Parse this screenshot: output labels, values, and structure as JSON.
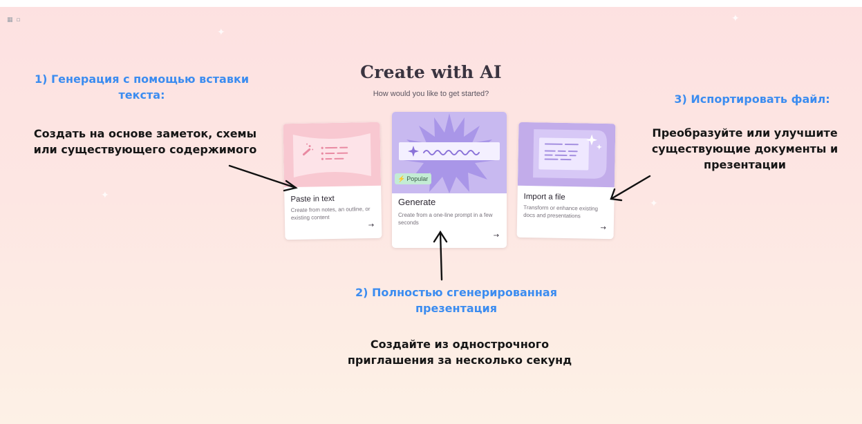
{
  "page": {
    "title": "Create with AI",
    "subtitle": "How would you like to get started?",
    "corner_icon": "window-control-icon"
  },
  "cards": {
    "paste": {
      "label": "Paste in text",
      "description": "Create from notes, an outline, or existing content",
      "arrow": "→",
      "art_icon": "magic-wand-icon",
      "art_color": "#f8c8d1"
    },
    "generate": {
      "badge": "Popular",
      "badge_icon": "bolt-icon",
      "label": "Generate",
      "description": "Create from a one-line prompt in a few seconds",
      "arrow": "→",
      "art_icon": "sparkle-icon",
      "art_color": "#c8b9f0"
    },
    "import": {
      "label": "Import a file",
      "description": "Transform or enhance existing docs and presentations",
      "arrow": "→",
      "art_icon": "sparkle-icon",
      "art_color": "#c2acea"
    }
  },
  "annotations": {
    "paste": {
      "heading": "1) Генерация с помощью вставки текста:",
      "body": "Создать на основе заметок, схемы или существующего содержимого"
    },
    "generate": {
      "heading": "2) Полностью сгенерированная презентация",
      "body": "Создайте из однострочного приглашения за несколько секунд"
    },
    "import": {
      "heading": "3) Испортировать файл:",
      "body": "Преобразуйте или улучшите существующие документы и презентации"
    }
  },
  "colors": {
    "annotation_heading": "#3b8cf0",
    "annotation_body": "#161616",
    "popular_badge": "#c3ecd4"
  }
}
